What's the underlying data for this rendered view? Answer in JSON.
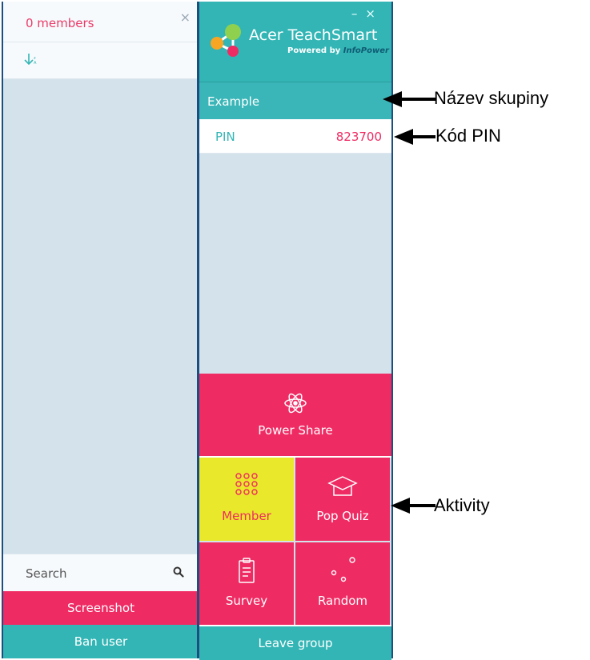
{
  "left_panel": {
    "members_count": "0 members",
    "close_glyph": "×",
    "sort_icon": "sort-az-icon",
    "search_label": "Search",
    "screenshot_label": "Screenshot",
    "ban_label": "Ban user"
  },
  "right_panel": {
    "window_minimize": "–",
    "window_close": "×",
    "app_title": "Acer TeachSmart",
    "powered_by": "Powered by ",
    "powered_brand": "InfoPower",
    "group_name": "Example",
    "pin_label": "PIN",
    "pin_code": "823700",
    "activities": {
      "power_share": "Power Share",
      "member": "Member",
      "pop_quiz": "Pop Quiz",
      "survey": "Survey",
      "random": "Random"
    },
    "leave_label": "Leave group"
  },
  "annotations": {
    "group_name_callout": "Název skupiny",
    "pin_callout": "Kód PIN",
    "activities_callout": "Aktivity"
  },
  "colors": {
    "teal": "#33b5b5",
    "pink": "#ef2b63",
    "yellow": "#e9e82a",
    "panel_bg": "#d4e2ec",
    "navy_border": "#1c4e80"
  }
}
